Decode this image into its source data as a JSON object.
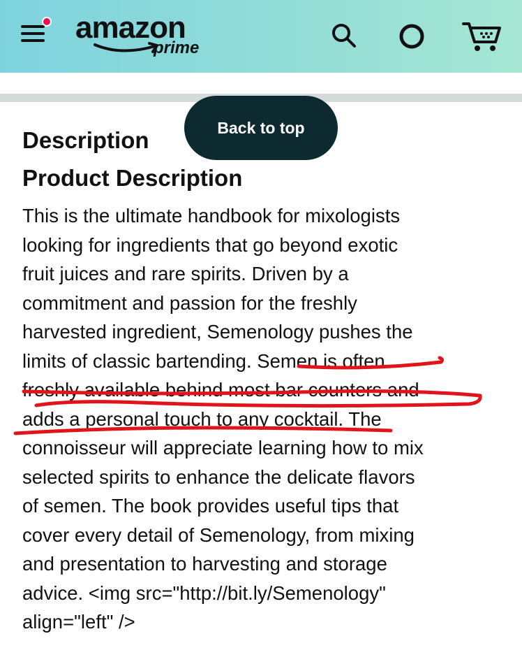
{
  "header": {
    "logo_word": "amazon",
    "logo_sub": "prime",
    "colors": {
      "gradient_start": "#7fd3df",
      "gradient_end": "#a6e6d3",
      "notification_dot": "#e8124f"
    },
    "icons": [
      "menu-icon",
      "search-icon",
      "alexa-icon",
      "cart-icon"
    ]
  },
  "back_to_top": {
    "label": "Back to top",
    "color": "#0c2a30"
  },
  "description": {
    "heading": "Description",
    "subheading": "Product Description",
    "lines": [
      "This is the ultimate handbook for mixologists",
      "looking for ingredients that go beyond exotic",
      "fruit juices and rare spirits. Driven by a",
      "commitment and passion for the freshly",
      "harvested ingredient, Semenology pushes the",
      "limits of classic bartending. Semen is often",
      "freshly available behind most bar counters and",
      "adds a personal touch to any cocktail. The",
      "connoisseur will appreciate learning how to mix",
      "selected spirits to enhance the delicate flavors",
      "of semen. The book provides useful tips that",
      "cover every detail of Semenology, from mixing",
      "and presentation to harvesting and storage",
      "advice. <img src=\"http://bit.ly/Semenology\"",
      "align=\"left\" />"
    ]
  },
  "annotation": {
    "color": "#e0141b"
  }
}
